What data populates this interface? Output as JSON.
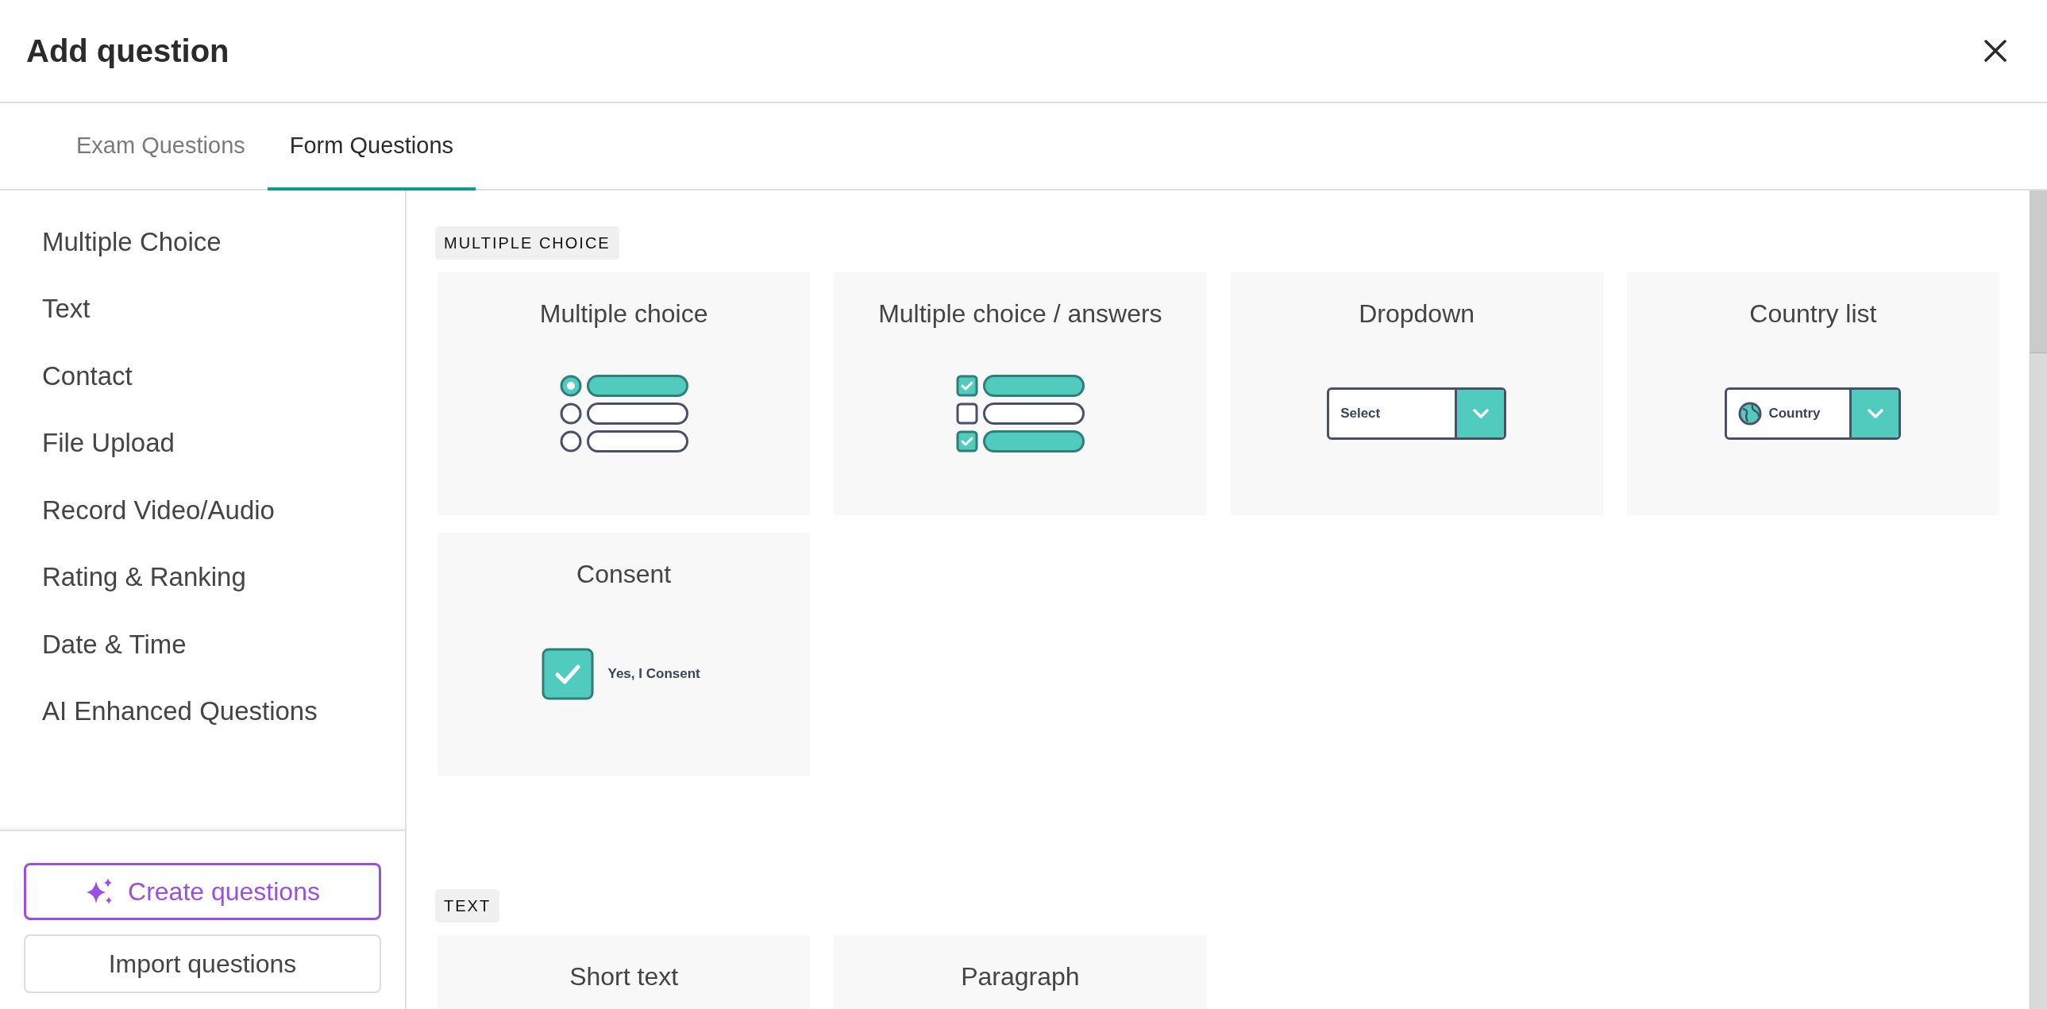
{
  "dialog": {
    "title": "Add question"
  },
  "tabs": [
    {
      "label": "Exam Questions",
      "selected": false
    },
    {
      "label": "Form Questions",
      "selected": true
    }
  ],
  "sidebar": {
    "items": [
      "Multiple Choice",
      "Text",
      "Contact",
      "File Upload",
      "Record Video/Audio",
      "Rating & Ranking",
      "Date & Time",
      "AI Enhanced Questions"
    ],
    "buttons": [
      {
        "label": "Create questions",
        "kind": "ai"
      },
      {
        "label": "Import questions",
        "kind": "plain"
      }
    ]
  },
  "sections": [
    {
      "heading": "MULTIPLE CHOICE",
      "cards": [
        {
          "title": "Multiple choice",
          "kind": "radio",
          "options": [
            {
              "selected": true
            },
            {
              "selected": false
            },
            {
              "selected": false
            }
          ]
        },
        {
          "title": "Multiple choice / answers",
          "kind": "checkbox",
          "options": [
            {
              "checked": true
            },
            {
              "checked": false
            },
            {
              "checked": true
            }
          ]
        },
        {
          "title": "Dropdown",
          "kind": "dropdown",
          "label": "Select"
        },
        {
          "title": "Country list",
          "kind": "country",
          "label": "Country"
        },
        {
          "title": "Consent",
          "kind": "consent",
          "label": "Yes, I Consent"
        }
      ]
    },
    {
      "heading": "TEXT",
      "cards": [
        {
          "title": "Short text",
          "kind": "none"
        },
        {
          "title": "Paragraph",
          "kind": "none"
        }
      ]
    }
  ]
}
